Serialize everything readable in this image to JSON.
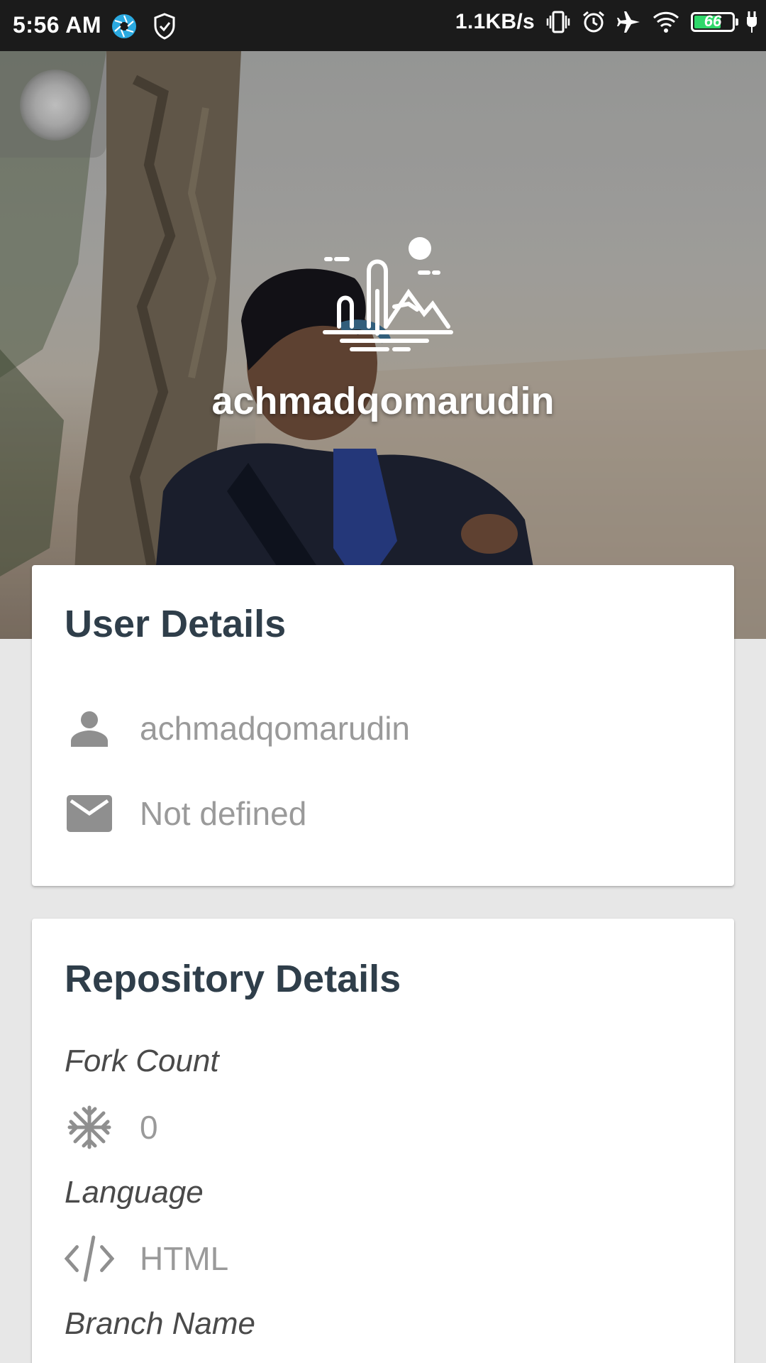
{
  "status_bar": {
    "time": "5:56 AM",
    "network_speed": "1.1KB/s",
    "battery_level": "66",
    "icons": [
      "aperture-app-icon",
      "shield-check-icon",
      "vibrate-icon",
      "alarm-icon",
      "airplane-icon",
      "wifi-icon",
      "battery-icon",
      "charging-icon"
    ]
  },
  "header": {
    "username": "achmadqomarudin",
    "logo_icon": "landscape-logo-icon",
    "floating_button_icon": "floating-ball-icon"
  },
  "user_details": {
    "title": "User Details",
    "items": [
      {
        "icon": "person-icon",
        "value": "achmadqomarudin"
      },
      {
        "icon": "mail-icon",
        "value": "Not defined"
      }
    ]
  },
  "repository_details": {
    "title": "Repository Details",
    "fork_count": {
      "label": "Fork Count",
      "icon": "fork-snowflake-icon",
      "value": "0"
    },
    "language": {
      "label": "Language",
      "icon": "code-icon",
      "value": "HTML"
    },
    "branch_name": {
      "label": "Branch Name"
    }
  },
  "colors": {
    "status_bar": "#1b1b1b",
    "card_title": "#2f3e4a",
    "detail_text": "#9a9a9a",
    "label_text": "#4a4a4a",
    "background": "#e7e7e7",
    "battery_fill": "#2fd86a"
  }
}
